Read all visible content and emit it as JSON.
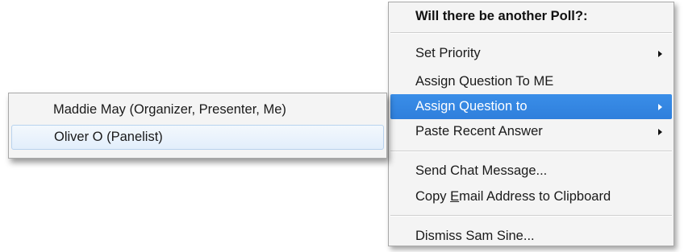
{
  "main_menu": {
    "header": "Will there be another Poll?:",
    "items": [
      {
        "label": "Set Priority",
        "submenu": true
      },
      {
        "label": "Assign Question To ME",
        "submenu": false
      },
      {
        "label": "Assign Question to",
        "submenu": true,
        "highlighted": true
      },
      {
        "label": "Paste Recent Answer",
        "submenu": true
      }
    ],
    "items_group2": [
      {
        "label": "Send Chat Message...",
        "submenu": false
      },
      {
        "label_pre": "Copy ",
        "label_accel": "E",
        "label_post": "mail Address to Clipboard",
        "submenu": false
      }
    ],
    "items_group3": [
      {
        "label": "Dismiss Sam Sine...",
        "submenu": false
      }
    ]
  },
  "submenu": {
    "items": [
      {
        "label": "Maddie May (Organizer, Presenter, Me)"
      },
      {
        "label": "Oliver O (Panelist)",
        "hovered": true
      }
    ]
  },
  "colors": {
    "highlight": "#2f7fdc",
    "menu_bg": "#f4f4f4",
    "hover_bg": "#e2eefb"
  },
  "icons": [
    "submenu-arrow-icon"
  ]
}
